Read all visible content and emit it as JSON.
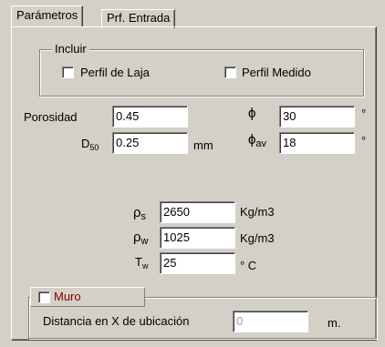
{
  "tabs": [
    {
      "label": "Parámetros",
      "active": true
    },
    {
      "label": "Prf. Entrada",
      "active": false
    }
  ],
  "incluir": {
    "title": "Incluir",
    "perfil_laja": {
      "label": "Perfil de Laja",
      "checked": false
    },
    "perfil_medido": {
      "label": "Perfil Medido",
      "checked": false
    }
  },
  "fields": {
    "porosidad": {
      "label": "Porosidad",
      "value": "0.45"
    },
    "d50": {
      "label": "D",
      "sub": "50",
      "value": "0.25",
      "unit": "mm"
    },
    "phi": {
      "label": "ϕ",
      "value": "30",
      "unit": "°"
    },
    "phi_av": {
      "label": "ϕ",
      "sub": "av",
      "value": "18",
      "unit": "°"
    },
    "rho_s": {
      "label": "ρ",
      "sub": "s",
      "value": "2650",
      "unit": "Kg/m3"
    },
    "rho_w": {
      "label": "ρ",
      "sub": "w",
      "value": "1025",
      "unit": "Kg/m3"
    },
    "t_w": {
      "label": "T",
      "sub": "w",
      "value": "25",
      "unit": "° C"
    }
  },
  "muro": {
    "label": "Muro",
    "checked": false,
    "label_color": "#800000",
    "distance_label": "Distancia en X de ubicación",
    "distance_value": "0",
    "distance_unit": "m."
  }
}
